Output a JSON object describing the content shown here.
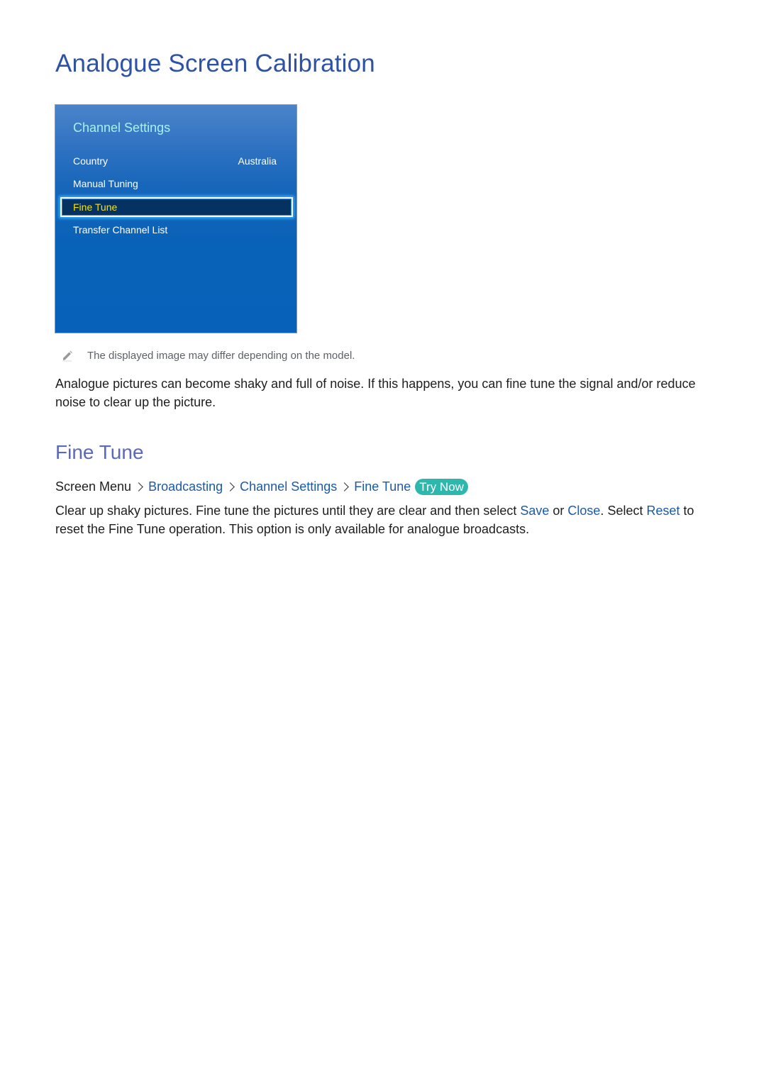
{
  "page": {
    "title": "Analogue Screen Calibration"
  },
  "tv_menu": {
    "title": "Channel Settings",
    "items": [
      {
        "label": "Country",
        "value": "Australia"
      },
      {
        "label": "Manual Tuning",
        "value": ""
      },
      {
        "label": "Fine Tune",
        "value": "",
        "selected": true
      },
      {
        "label": "Transfer Channel List",
        "value": ""
      }
    ],
    "colors": {
      "background": "#0761b8",
      "title": "#a9f1ec",
      "selected_bg": "#063262",
      "selected_text": "#f3e20f"
    }
  },
  "note": {
    "icon": "pencil-icon",
    "text": "The displayed image may differ depending on the model."
  },
  "intro": {
    "text": "Analogue pictures can become shaky and full of noise. If this happens, you can fine tune the signal and/or reduce noise to clear up the picture."
  },
  "section": {
    "heading": "Fine Tune",
    "breadcrumb": [
      {
        "label": "Screen Menu",
        "link": false
      },
      {
        "label": "Broadcasting",
        "link": true
      },
      {
        "label": "Channel Settings",
        "link": true
      },
      {
        "label": "Fine Tune",
        "link": true
      }
    ],
    "try_now": "Try Now",
    "body": {
      "part1": "Clear up shaky pictures. Fine tune the pictures until they are clear and then select ",
      "save": "Save",
      "part2": " or ",
      "close": "Close",
      "part3": ". Select ",
      "reset": "Reset",
      "part4": " to reset the Fine Tune operation. This option is only available for analogue broadcasts."
    }
  },
  "colors": {
    "title": "#2e52a6",
    "heading": "#5a68bd",
    "link": "#1b5aa6",
    "try_now_bg": "#2db7ad"
  }
}
